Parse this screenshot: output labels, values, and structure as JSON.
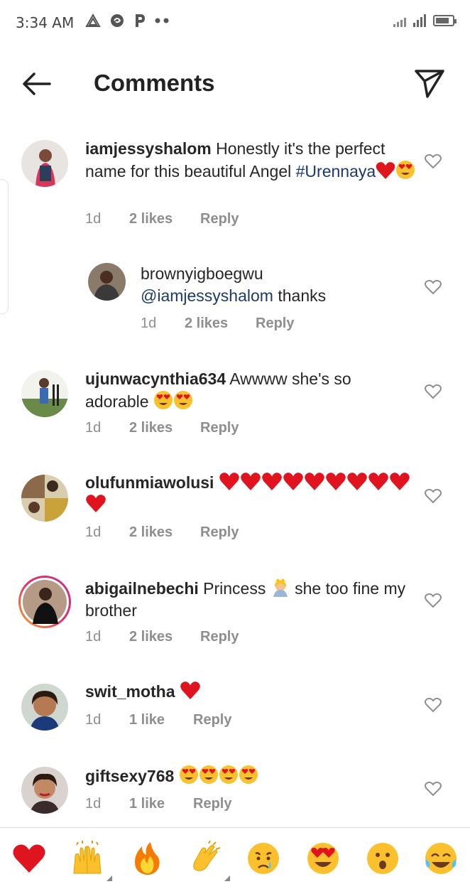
{
  "status_bar": {
    "time": "3:34 AM"
  },
  "header": {
    "title": "Comments"
  },
  "comments": [
    {
      "username": "iamjessyshalom",
      "text": "Honestly it's the perfect name for this beautiful Angel",
      "hashtag": "#Urennaya",
      "time": "1d",
      "likes": "2 likes",
      "reply": "Reply"
    },
    {
      "username": "brownyigboegwu",
      "mention": "@iamjessyshalom",
      "text": "thanks",
      "time": "1d",
      "likes": "2 likes",
      "reply": "Reply"
    },
    {
      "username": "ujunwacynthia634",
      "text": "Awwww she's so adorable",
      "time": "1d",
      "likes": "2 likes",
      "reply": "Reply"
    },
    {
      "username": "olufunmiawolusi",
      "text": "",
      "time": "1d",
      "likes": "2 likes",
      "reply": "Reply"
    },
    {
      "username": "abigailnebechi",
      "text_part1": "Princess",
      "text_part2": "she too fine my brother",
      "time": "1d",
      "likes": "2 likes",
      "reply": "Reply"
    },
    {
      "username": "swit_motha",
      "text": "",
      "time": "1d",
      "likes": "1 like",
      "reply": "Reply"
    },
    {
      "username": "giftsexy768",
      "text": "",
      "time": "1d",
      "likes": "1 like",
      "reply": "Reply"
    }
  ],
  "emoji_bar": [
    "red-heart",
    "raising-hands",
    "fire",
    "clapping-hands",
    "crying-face",
    "heart-eyes-face",
    "surprised-face",
    "tears-of-joy-face"
  ],
  "colors": {
    "accent_text": "#1b3a6b",
    "meta_gray": "#8e8e8e",
    "heart_red": "#e0141e"
  }
}
